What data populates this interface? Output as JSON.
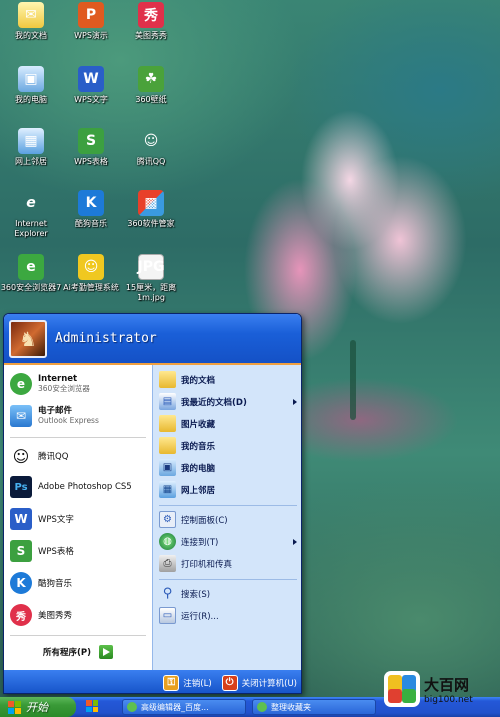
{
  "desktop_icons": [
    {
      "label": "我的文档",
      "icon": "folder-documents-icon",
      "glyph": "✉"
    },
    {
      "label": "WPS演示",
      "icon": "wps-presentation-icon",
      "glyph": "P"
    },
    {
      "label": "美图秀秀",
      "icon": "meitu-icon",
      "glyph": "秀"
    },
    {
      "label": "我的电脑",
      "icon": "computer-icon",
      "glyph": "▣"
    },
    {
      "label": "WPS文字",
      "icon": "wps-writer-icon",
      "glyph": "W"
    },
    {
      "label": "360壁纸",
      "icon": "wallpaper-360-icon",
      "glyph": "☘"
    },
    {
      "label": "网上邻居",
      "icon": "network-icon",
      "glyph": "▦"
    },
    {
      "label": "WPS表格",
      "icon": "wps-spreadsheet-icon",
      "glyph": "S"
    },
    {
      "label": "腾讯QQ",
      "icon": "qq-icon",
      "glyph": "☺"
    },
    {
      "label": "Internet\nExplorer",
      "icon": "internet-explorer-icon",
      "glyph": "e"
    },
    {
      "label": "酷狗音乐",
      "icon": "kugou-icon",
      "glyph": "K"
    },
    {
      "label": "360软件管家",
      "icon": "software-manager-icon",
      "glyph": "▩"
    },
    {
      "label": "360安全浏览器7",
      "icon": "browser-360-icon",
      "glyph": "e"
    },
    {
      "label": "Ai考勤管理系统",
      "icon": "attendance-icon",
      "glyph": "☺"
    },
    {
      "label": "15厘米，距离1m.jpg",
      "icon": "jpg-file-icon",
      "glyph": "JPG"
    }
  ],
  "start_menu": {
    "username": "Administrator",
    "pinned": [
      {
        "title": "Internet",
        "subtitle": "360安全浏览器",
        "icon": "browser-360-icon"
      },
      {
        "title": "电子邮件",
        "subtitle": "Outlook Express",
        "icon": "email-icon"
      }
    ],
    "recent": [
      {
        "label": "腾讯QQ",
        "icon": "qq-icon",
        "glyph": "☺"
      },
      {
        "label": "Adobe Photoshop CS5",
        "icon": "photoshop-icon",
        "glyph": "Ps"
      },
      {
        "label": "WPS文字",
        "icon": "wps-writer-icon",
        "glyph": "W"
      },
      {
        "label": "WPS表格",
        "icon": "wps-spreadsheet-icon",
        "glyph": "S"
      },
      {
        "label": "酷狗音乐",
        "icon": "kugou-icon",
        "glyph": "K"
      },
      {
        "label": "美图秀秀",
        "icon": "meitu-icon",
        "glyph": "秀"
      }
    ],
    "all_programs": "所有程序(P)",
    "places": [
      {
        "label": "我的文档",
        "bold": true,
        "icon": "folder-documents-icon"
      },
      {
        "label": "我最近的文档(D)",
        "bold": true,
        "icon": "recent-documents-icon",
        "submenu": true
      },
      {
        "label": "图片收藏",
        "bold": true,
        "icon": "folder-pictures-icon"
      },
      {
        "label": "我的音乐",
        "bold": true,
        "icon": "folder-music-icon"
      },
      {
        "label": "我的电脑",
        "bold": true,
        "icon": "computer-icon"
      },
      {
        "label": "网上邻居",
        "bold": true,
        "icon": "network-icon"
      }
    ],
    "system": [
      {
        "label": "控制面板(C)",
        "icon": "control-panel-icon"
      },
      {
        "label": "连接到(T)",
        "icon": "connect-to-icon",
        "submenu": true
      },
      {
        "label": "打印机和传真",
        "icon": "printer-icon"
      }
    ],
    "tools": [
      {
        "label": "搜索(S)",
        "icon": "search-icon"
      },
      {
        "label": "运行(R)...",
        "icon": "run-icon"
      }
    ],
    "logoff": "注销(L)",
    "shutdown": "关闭计算机(U)"
  },
  "taskbar": {
    "start_label": "开始",
    "tasks": [
      "高级编辑器_百度...",
      "整理收藏夹"
    ]
  },
  "watermark": {
    "title": "大百网",
    "url": "big100.net"
  },
  "colors": {
    "xp_blue": "#1451c6",
    "start_green": "#3a9a38",
    "menu_right_bg": "#d3e5fa"
  }
}
